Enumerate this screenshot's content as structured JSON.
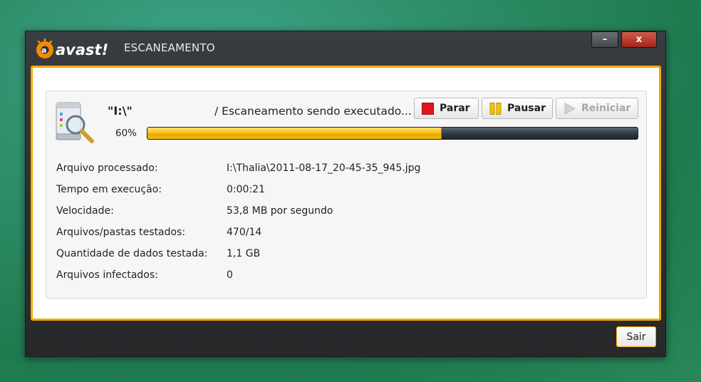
{
  "window": {
    "logo_text": "avast!",
    "title": "ESCANEAMENTO",
    "minimize_glyph": "–",
    "close_glyph": "x"
  },
  "scan": {
    "icon": "magnifier-drive-icon",
    "drive": "\"I:\\\"",
    "status": "/ Escaneamento sendo executado...",
    "progress_label": "60%",
    "progress_fraction": 0.6,
    "buttons": {
      "stop": "Parar",
      "pause": "Pausar",
      "restart": "Reiniciar"
    }
  },
  "details": [
    {
      "label": "Arquivo processado:",
      "value": "I:\\Thalia\\2011-08-17_20-45-35_945.jpg"
    },
    {
      "label": "Tempo em execução:",
      "value": "0:00:21"
    },
    {
      "label": "Velocidade:",
      "value": "53,8 MB por segundo"
    },
    {
      "label": "Arquivos/pastas testados:",
      "value": "470/14"
    },
    {
      "label": "Quantidade de dados testada:",
      "value": "1,1 GB"
    },
    {
      "label": "Arquivos infectados:",
      "value": "0"
    }
  ],
  "footer": {
    "exit_label": "Sair"
  },
  "colors": {
    "accent": "#f2a900",
    "stop": "#e0161b",
    "pause": "#f3c400"
  }
}
